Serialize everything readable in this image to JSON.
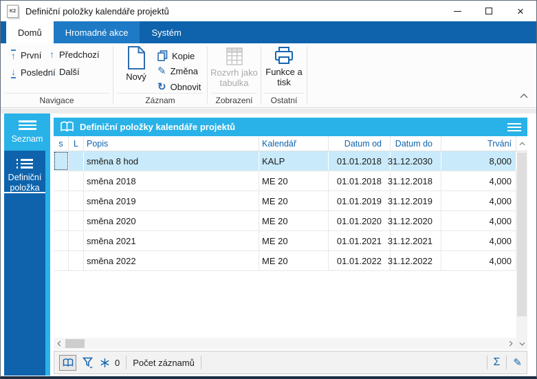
{
  "window": {
    "title": "Definiční položky kalendáře projektů",
    "icon_text": "K2"
  },
  "tabs": {
    "items": [
      {
        "label": "Domů",
        "active": true
      },
      {
        "label": "Hromadné akce",
        "active": false
      },
      {
        "label": "Systém",
        "active": false
      }
    ]
  },
  "ribbon": {
    "groups": [
      {
        "label": "Navigace",
        "buttons": [
          {
            "label": "První",
            "icon": "arrow-up-to-bar"
          },
          {
            "label": "Poslední",
            "icon": "arrow-down-to-bar"
          },
          {
            "label": "Předchozí",
            "icon": "arrow-up"
          },
          {
            "label": "Další",
            "icon": "arrow-down"
          }
        ]
      },
      {
        "label": "Záznam",
        "buttons": [
          {
            "label": "Nový",
            "icon": "new-document"
          },
          {
            "label": "Kopie",
            "icon": "copy"
          },
          {
            "label": "Změna",
            "icon": "pencil"
          },
          {
            "label": "Obnovit",
            "icon": "refresh"
          }
        ]
      },
      {
        "label": "Zobrazení",
        "buttons": [
          {
            "label": "Rozvrh jako tabulka",
            "icon": "table-grid",
            "disabled": true
          }
        ]
      },
      {
        "label": "Ostatní",
        "buttons": [
          {
            "label": "Funkce a tisk",
            "icon": "printer"
          }
        ]
      }
    ]
  },
  "sidebar": {
    "items": [
      {
        "label": "Seznam",
        "icon": "list-icon",
        "active": true
      },
      {
        "label": "Definiční položka",
        "icon": "detail-list-icon",
        "active": false
      }
    ]
  },
  "panel": {
    "title": "Definiční položky kalendáře projektů"
  },
  "table": {
    "columns": [
      "s",
      "L",
      "Popis",
      "Kalendář",
      "Datum od",
      "Datum do",
      "Trvání"
    ],
    "rows": [
      {
        "cells": [
          "",
          "",
          "směna 8 hod",
          "KALP",
          "01.01.2018",
          "31.12.2030",
          "8,000"
        ],
        "selected": true
      },
      {
        "cells": [
          "",
          "",
          "směna 2018",
          "ME 20",
          "01.01.2018",
          "31.12.2018",
          "4,000"
        ],
        "selected": false
      },
      {
        "cells": [
          "",
          "",
          "směna 2019",
          "ME 20",
          "01.01.2019",
          "31.12.2019",
          "4,000"
        ],
        "selected": false
      },
      {
        "cells": [
          "",
          "",
          "směna 2020",
          "ME 20",
          "01.01.2020",
          "31.12.2020",
          "4,000"
        ],
        "selected": false
      },
      {
        "cells": [
          "",
          "",
          "směna 2021",
          "ME 20",
          "01.01.2021",
          "31.12.2021",
          "4,000"
        ],
        "selected": false
      },
      {
        "cells": [
          "",
          "",
          "směna 2022",
          "ME 20",
          "01.01.2022",
          "31.12.2022",
          "4,000"
        ],
        "selected": false
      }
    ]
  },
  "statusbar": {
    "frozen_count": "0",
    "records_label": "Počet záznamů"
  },
  "colors": {
    "dark_blue": "#0e63ac",
    "cyan": "#29b2e8",
    "tab_highlight": "#1e7ac4",
    "selected_row": "#c9eafa",
    "header_text": "#0e63ac"
  }
}
